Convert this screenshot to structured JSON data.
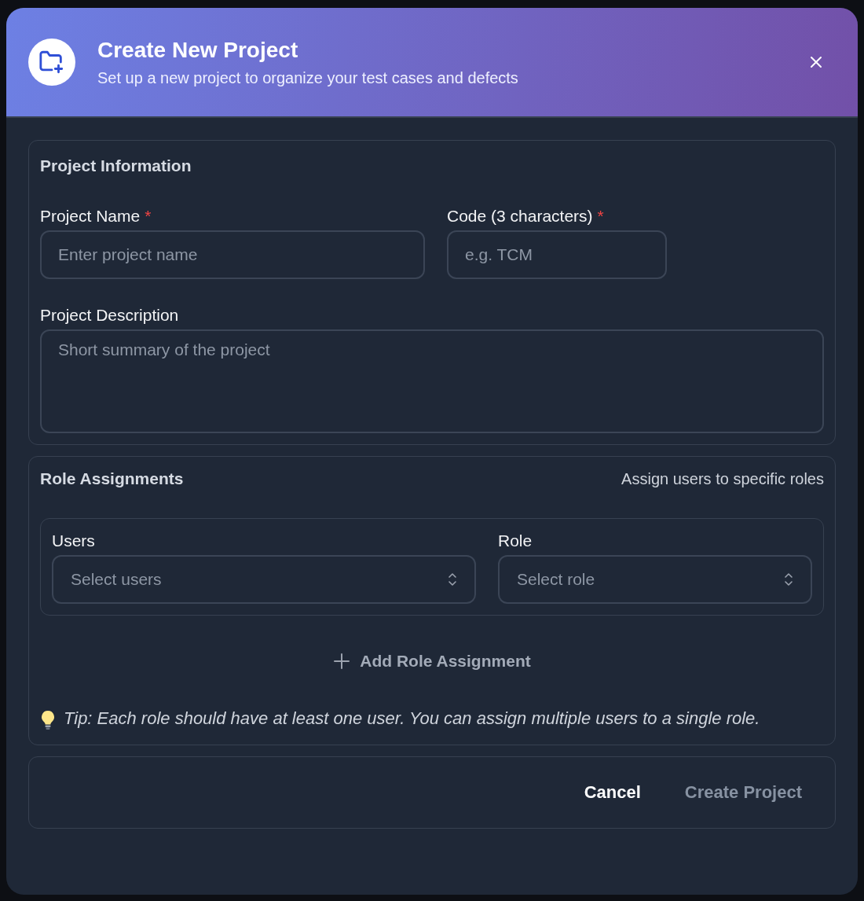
{
  "dialog": {
    "title": "Create New Project",
    "subtitle": "Set up a new project to organize your test cases and defects"
  },
  "project_information": {
    "heading": "Project Information",
    "fields": [
      {
        "kind": "input",
        "label": "Project Name",
        "required_mark": "*",
        "placeholder": "Enter project name"
      },
      {
        "kind": "input",
        "label": "Code (3 characters)",
        "required_mark": "*",
        "placeholder": "e.g. TCM"
      },
      {
        "kind": "textarea",
        "label": "Project Description",
        "placeholder": "Short summary of the project"
      }
    ]
  },
  "role_assignments": {
    "heading": "Role Assignments",
    "hint": "Assign users to specific roles",
    "selects": [
      {
        "label": "Users",
        "placeholder": "Select users"
      },
      {
        "label": "Role",
        "placeholder": "Select role"
      }
    ],
    "add_button": "Add Role Assignment",
    "tip": "*Tip: Each role should have at least one user. You can assign multiple users to a single role.*"
  },
  "footer": {
    "buttons": [
      {
        "label": "Cancel",
        "disabled": false
      },
      {
        "label": "Create Project",
        "disabled": true
      }
    ]
  }
}
